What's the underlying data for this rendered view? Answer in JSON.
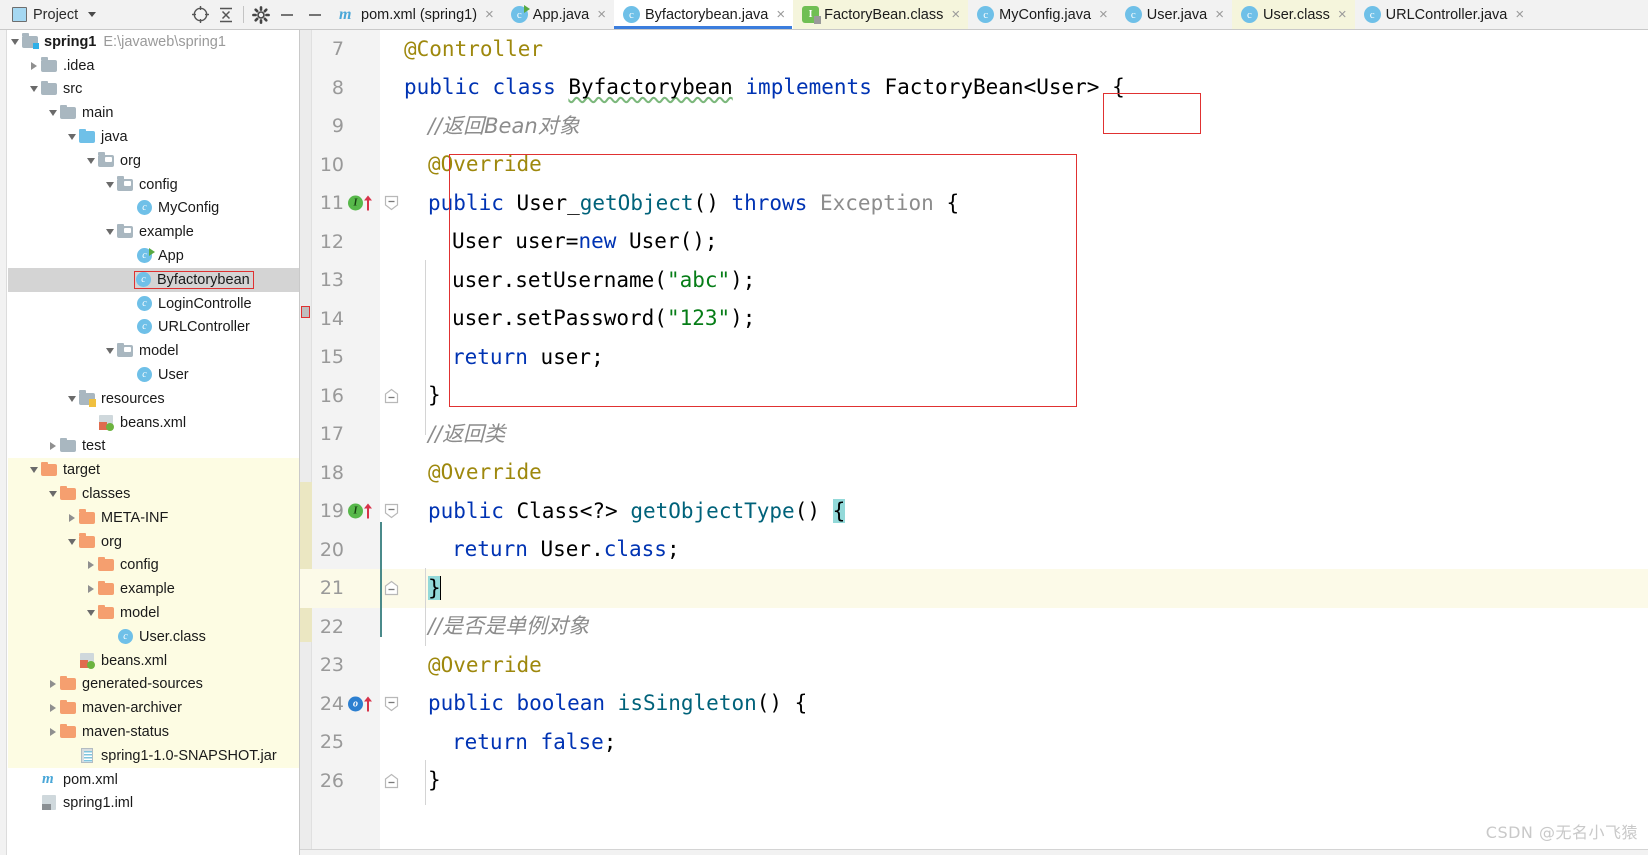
{
  "project_toolbar": {
    "title": "Project",
    "icons": [
      {
        "name": "locate-icon",
        "glyph": "locate"
      },
      {
        "name": "collapse-all-icon",
        "glyph": "collapse"
      },
      {
        "name": "settings-gear-icon",
        "glyph": "gear"
      },
      {
        "name": "hide-panel-icon",
        "glyph": "minus"
      }
    ]
  },
  "tabs": {
    "hide_label": "—",
    "items": [
      {
        "label": "pom.xml (spring1)",
        "icon": "maven-m-icon",
        "style": "plain",
        "active": false,
        "close": "×"
      },
      {
        "label": "App.java",
        "icon": "java-class-run-icon",
        "style": "plain",
        "active": false,
        "close": "×"
      },
      {
        "label": "Byfactorybean.java",
        "icon": "java-class-icon",
        "style": "active",
        "active": true,
        "close": "×"
      },
      {
        "label": "FactoryBean.class",
        "icon": "java-interface-class-icon",
        "style": "class",
        "active": false,
        "close": "×"
      },
      {
        "label": "MyConfig.java",
        "icon": "java-class-icon",
        "style": "plain",
        "active": false,
        "close": "×"
      },
      {
        "label": "User.java",
        "icon": "java-class-icon",
        "style": "plain",
        "active": false,
        "close": "×"
      },
      {
        "label": "User.class",
        "icon": "java-class-icon",
        "style": "class",
        "active": false,
        "close": "×"
      },
      {
        "label": "URLController.java",
        "icon": "java-class-icon",
        "style": "plain",
        "active": false,
        "close": "×"
      }
    ]
  },
  "tree": {
    "items": [
      {
        "depth": 0,
        "toggle": "down",
        "icon": "module-folder",
        "label": "spring1",
        "bold": true,
        "path": "E:\\javaweb\\spring1"
      },
      {
        "depth": 1,
        "toggle": "right",
        "icon": "folder",
        "label": ".idea"
      },
      {
        "depth": 1,
        "toggle": "down",
        "icon": "folder",
        "label": "src"
      },
      {
        "depth": 2,
        "toggle": "down",
        "icon": "folder",
        "label": "main"
      },
      {
        "depth": 3,
        "toggle": "down",
        "icon": "source-folder",
        "label": "java"
      },
      {
        "depth": 4,
        "toggle": "down",
        "icon": "package",
        "label": "org"
      },
      {
        "depth": 5,
        "toggle": "down",
        "icon": "package",
        "label": "config"
      },
      {
        "depth": 6,
        "toggle": "none",
        "icon": "java-class",
        "label": "MyConfig"
      },
      {
        "depth": 5,
        "toggle": "down",
        "icon": "package",
        "label": "example"
      },
      {
        "depth": 6,
        "toggle": "none",
        "icon": "java-class-run",
        "label": "App"
      },
      {
        "depth": 6,
        "toggle": "none",
        "icon": "java-class",
        "label": "Byfactorybean",
        "selected": true,
        "annotated": true
      },
      {
        "depth": 6,
        "toggle": "none",
        "icon": "java-class",
        "label": "LoginControlle"
      },
      {
        "depth": 6,
        "toggle": "none",
        "icon": "java-class",
        "label": "URLController"
      },
      {
        "depth": 5,
        "toggle": "down",
        "icon": "package",
        "label": "model"
      },
      {
        "depth": 6,
        "toggle": "none",
        "icon": "java-class",
        "label": "User"
      },
      {
        "depth": 3,
        "toggle": "down",
        "icon": "resource-folder",
        "label": "resources"
      },
      {
        "depth": 4,
        "toggle": "none",
        "icon": "spring-xml",
        "label": "beans.xml"
      },
      {
        "depth": 2,
        "toggle": "right",
        "icon": "folder",
        "label": "test"
      },
      {
        "depth": 1,
        "toggle": "down",
        "icon": "folder-orange",
        "label": "target",
        "target": true
      },
      {
        "depth": 2,
        "toggle": "down",
        "icon": "folder-orange",
        "label": "classes",
        "target": true
      },
      {
        "depth": 3,
        "toggle": "right",
        "icon": "folder-orange",
        "label": "META-INF",
        "target": true
      },
      {
        "depth": 3,
        "toggle": "down",
        "icon": "folder-orange",
        "label": "org",
        "target": true
      },
      {
        "depth": 4,
        "toggle": "right",
        "icon": "folder-orange",
        "label": "config",
        "target": true
      },
      {
        "depth": 4,
        "toggle": "right",
        "icon": "folder-orange",
        "label": "example",
        "target": true
      },
      {
        "depth": 4,
        "toggle": "down",
        "icon": "folder-orange",
        "label": "model",
        "target": true
      },
      {
        "depth": 5,
        "toggle": "none",
        "icon": "java-class",
        "label": "User.class",
        "target": true
      },
      {
        "depth": 3,
        "toggle": "none",
        "icon": "spring-xml",
        "label": "beans.xml",
        "target": true
      },
      {
        "depth": 2,
        "toggle": "right",
        "icon": "folder-orange",
        "label": "generated-sources",
        "target": true
      },
      {
        "depth": 2,
        "toggle": "right",
        "icon": "folder-orange",
        "label": "maven-archiver",
        "target": true
      },
      {
        "depth": 2,
        "toggle": "right",
        "icon": "folder-orange",
        "label": "maven-status",
        "target": true
      },
      {
        "depth": 3,
        "toggle": "none",
        "icon": "jar",
        "label": "spring1-1.0-SNAPSHOT.jar",
        "target": true
      },
      {
        "depth": 1,
        "toggle": "none",
        "icon": "maven-m",
        "label": "pom.xml"
      },
      {
        "depth": 1,
        "toggle": "none",
        "icon": "iml",
        "label": "spring1.iml"
      }
    ]
  },
  "editor": {
    "file": "Byfactorybean.java",
    "current_line": 21,
    "lines": [
      {
        "n": 7,
        "indent": 0,
        "gutter": null,
        "fold": null,
        "tokens": [
          {
            "t": "@Controller",
            "c": "ann"
          }
        ]
      },
      {
        "n": 8,
        "indent": 0,
        "gutter": null,
        "fold": null,
        "tokens": [
          {
            "t": "public ",
            "c": "kw"
          },
          {
            "t": "class ",
            "c": "kw"
          },
          {
            "t": "Byfactorybean",
            "c": "squig"
          },
          {
            "t": " ",
            "c": "typ"
          },
          {
            "t": "implements",
            "c": "kw"
          },
          {
            "t": " FactoryBean",
            "c": "typ"
          },
          {
            "t": "<User>",
            "c": "typ"
          },
          {
            "t": " {",
            "c": "typ"
          }
        ]
      },
      {
        "n": 9,
        "indent": 1,
        "gutter": null,
        "fold": null,
        "tokens": [
          {
            "t": "//返回Bean对象",
            "c": "cmt"
          }
        ]
      },
      {
        "n": 10,
        "indent": 1,
        "gutter": null,
        "fold": null,
        "tokens": [
          {
            "t": "@Override",
            "c": "ann"
          }
        ]
      },
      {
        "n": 11,
        "indent": 1,
        "gutter": "implements-green",
        "fold": "collapse-top",
        "tokens": [
          {
            "t": "public ",
            "c": "kw"
          },
          {
            "t": "User",
            "c": "typ"
          },
          {
            "t": "_",
            "c": "typ"
          },
          {
            "t": "getObject",
            "c": "mth"
          },
          {
            "t": "() ",
            "c": "typ"
          },
          {
            "t": "throws",
            "c": "kw"
          },
          {
            "t": " ",
            "c": "typ"
          },
          {
            "t": "Exception",
            "c": "gray"
          },
          {
            "t": " {",
            "c": "typ"
          }
        ]
      },
      {
        "n": 12,
        "indent": 2,
        "gutter": null,
        "fold": null,
        "tokens": [
          {
            "t": "User user=",
            "c": "typ"
          },
          {
            "t": "new",
            "c": "kw"
          },
          {
            "t": " User();",
            "c": "typ"
          }
        ]
      },
      {
        "n": 13,
        "indent": 2,
        "gutter": null,
        "fold": null,
        "tokens": [
          {
            "t": "user.setUsername(",
            "c": "typ"
          },
          {
            "t": "\"abc\"",
            "c": "str"
          },
          {
            "t": ");",
            "c": "typ"
          }
        ]
      },
      {
        "n": 14,
        "indent": 2,
        "gutter": null,
        "fold": null,
        "tokens": [
          {
            "t": "user.setPassword(",
            "c": "typ"
          },
          {
            "t": "\"123\"",
            "c": "str"
          },
          {
            "t": ");",
            "c": "typ"
          }
        ]
      },
      {
        "n": 15,
        "indent": 2,
        "gutter": null,
        "fold": null,
        "tokens": [
          {
            "t": "return",
            "c": "kw"
          },
          {
            "t": " user;",
            "c": "typ"
          }
        ]
      },
      {
        "n": 16,
        "indent": 1,
        "gutter": null,
        "fold": "collapse-bottom",
        "tokens": [
          {
            "t": "}",
            "c": "typ"
          }
        ]
      },
      {
        "n": 17,
        "indent": 1,
        "gutter": null,
        "fold": null,
        "tokens": [
          {
            "t": "//返回类",
            "c": "cmt"
          }
        ]
      },
      {
        "n": 18,
        "indent": 1,
        "gutter": null,
        "fold": null,
        "tokens": [
          {
            "t": "@Override",
            "c": "ann"
          }
        ]
      },
      {
        "n": 19,
        "indent": 1,
        "gutter": "implements-green",
        "fold": "collapse-top",
        "tokens": [
          {
            "t": "public ",
            "c": "kw"
          },
          {
            "t": "Class<?> ",
            "c": "typ"
          },
          {
            "t": "getObjectType",
            "c": "mth"
          },
          {
            "t": "() ",
            "c": "typ"
          },
          {
            "t": "{",
            "c": "brace"
          }
        ]
      },
      {
        "n": 20,
        "indent": 2,
        "gutter": null,
        "fold": null,
        "tokens": [
          {
            "t": "return",
            "c": "kw"
          },
          {
            "t": " User.",
            "c": "typ"
          },
          {
            "t": "class",
            "c": "kw"
          },
          {
            "t": ";",
            "c": "typ"
          }
        ]
      },
      {
        "n": 21,
        "indent": 1,
        "gutter": null,
        "fold": "collapse-bottom",
        "tokens": [
          {
            "t": "}",
            "c": "brace"
          },
          {
            "t": "",
            "c": "caret"
          }
        ]
      },
      {
        "n": 22,
        "indent": 1,
        "gutter": null,
        "fold": null,
        "tokens": [
          {
            "t": "//是否是单例对象",
            "c": "cmt"
          }
        ]
      },
      {
        "n": 23,
        "indent": 1,
        "gutter": null,
        "fold": null,
        "tokens": [
          {
            "t": "@Override",
            "c": "ann"
          }
        ]
      },
      {
        "n": 24,
        "indent": 1,
        "gutter": "implements-blue",
        "fold": "collapse-top",
        "tokens": [
          {
            "t": "public ",
            "c": "kw"
          },
          {
            "t": "boolean ",
            "c": "kw"
          },
          {
            "t": "isSingleton",
            "c": "mth"
          },
          {
            "t": "() {",
            "c": "typ"
          }
        ]
      },
      {
        "n": 25,
        "indent": 2,
        "gutter": null,
        "fold": null,
        "tokens": [
          {
            "t": "return",
            "c": "kw"
          },
          {
            "t": " ",
            "c": "typ"
          },
          {
            "t": "false",
            "c": "kw"
          },
          {
            "t": ";",
            "c": "typ"
          }
        ]
      },
      {
        "n": 26,
        "indent": 1,
        "gutter": null,
        "fold": "collapse-bottom",
        "tokens": [
          {
            "t": "}",
            "c": "typ"
          }
        ]
      }
    ]
  },
  "annotations": {
    "generic_box_label": "<User>",
    "method_box_lines": "10-16",
    "tree_box_label": "Byfactorybean",
    "box_color": "#e03131"
  },
  "watermark": {
    "text": "CSDN @无名小飞猿"
  },
  "colors": {
    "accent_tab": "#3b7ddd",
    "class_tab_bg": "#f5f5dc",
    "target_bg": "#fdfce3",
    "selection": "#d4d4d4",
    "current_line": "#fcfae8",
    "keyword": "#0033b3",
    "annotation_text": "#9e880d",
    "string": "#067d17",
    "comment": "#8c8c8c",
    "method": "#00627a",
    "brace_match": "#93d9d9"
  }
}
